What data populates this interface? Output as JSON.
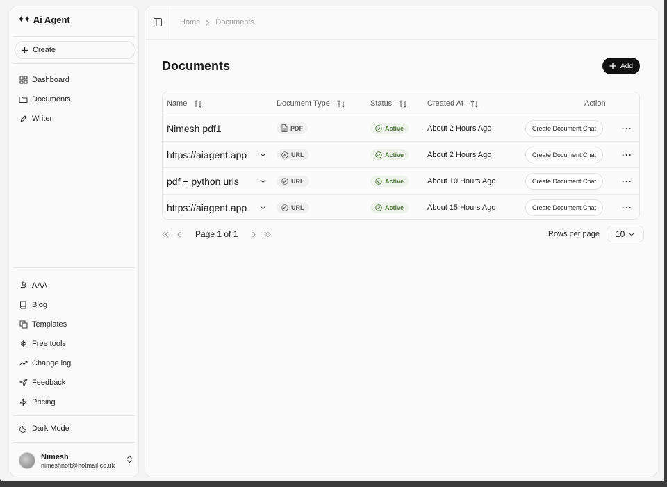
{
  "app": {
    "brand": "Ai Agent",
    "brand_icon": "sparkles-icon"
  },
  "sidebar": {
    "create_label": "Create",
    "primary_nav": [
      {
        "label": "Dashboard",
        "icon": "dashboard-icon"
      },
      {
        "label": "Documents",
        "icon": "folder-icon"
      },
      {
        "label": "Writer",
        "icon": "pen-icon"
      }
    ],
    "secondary_nav": [
      {
        "label": "AAA",
        "icon": "bitcoin-icon"
      },
      {
        "label": "Blog",
        "icon": "book-icon"
      },
      {
        "label": "Templates",
        "icon": "templates-icon"
      },
      {
        "label": "Free tools",
        "icon": "snowflake-icon"
      },
      {
        "label": "Change log",
        "icon": "trend-icon"
      },
      {
        "label": "Feedback",
        "icon": "send-icon"
      },
      {
        "label": "Pricing",
        "icon": "bolt-icon"
      }
    ],
    "dark_mode_label": "Dark Mode",
    "user": {
      "name": "Nimesh",
      "email": "nimeshnott@hotmail.co.uk"
    }
  },
  "header": {
    "breadcrumb": [
      "Home",
      "Documents"
    ]
  },
  "page": {
    "title": "Documents",
    "add_label": "Add"
  },
  "table": {
    "columns": [
      "Name",
      "Document Type",
      "Status",
      "Created At",
      "Action"
    ],
    "rows": [
      {
        "name": "Nimesh pdf1",
        "expandable": false,
        "type": "PDF",
        "status": "Active",
        "created": "About 2 Hours Ago",
        "action": "Create Document Chat"
      },
      {
        "name": "https://aiagent.app",
        "expandable": true,
        "type": "URL",
        "status": "Active",
        "created": "About 2 Hours Ago",
        "action": "Create Document Chat"
      },
      {
        "name": "pdf + python urls",
        "expandable": true,
        "type": "URL",
        "status": "Active",
        "created": "About 10 Hours Ago",
        "action": "Create Document Chat"
      },
      {
        "name": "https://aiagent.app",
        "expandable": true,
        "type": "URL",
        "status": "Active",
        "created": "About 15 Hours Ago",
        "action": "Create Document Chat"
      }
    ]
  },
  "pagination": {
    "page_label": "Page 1 of 1",
    "rows_per_page_label": "Rows per page",
    "rows_per_page_value": "10"
  },
  "colors": {
    "active_badge_text": "#4f7a3a",
    "add_button_bg": "#111111"
  }
}
